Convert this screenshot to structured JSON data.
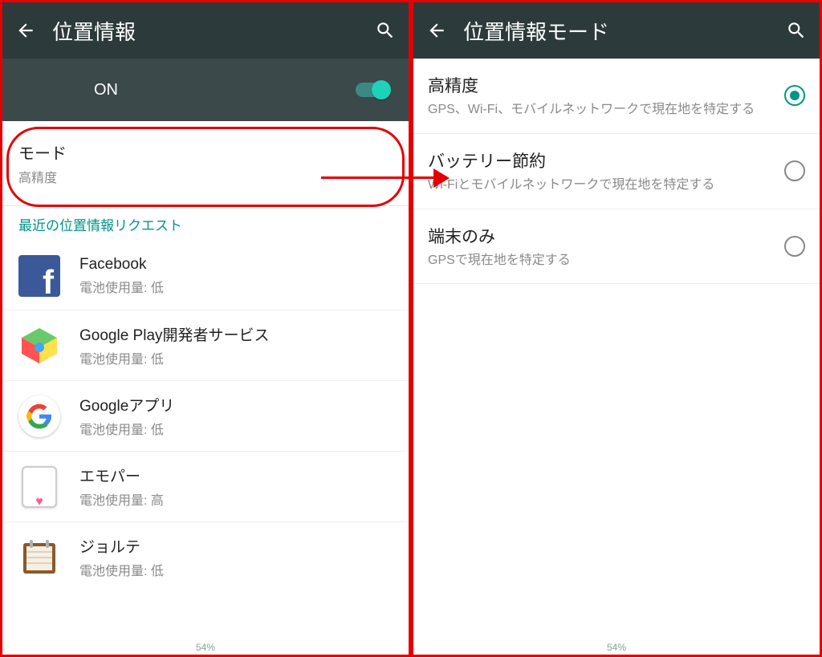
{
  "left": {
    "title": "位置情報",
    "toggle_label": "ON",
    "mode": {
      "label": "モード",
      "value": "高精度"
    },
    "recent_header": "最近の位置情報リクエスト",
    "apps": [
      {
        "name": "Facebook",
        "battery": "電池使用量: 低"
      },
      {
        "name": "Google Play開発者サービス",
        "battery": "電池使用量: 低"
      },
      {
        "name": "Googleアプリ",
        "battery": "電池使用量: 低"
      },
      {
        "name": "エモパー",
        "battery": "電池使用量: 高"
      },
      {
        "name": "ジョルテ",
        "battery": "電池使用量: 低"
      }
    ],
    "footer": "54%"
  },
  "right": {
    "title": "位置情報モード",
    "options": [
      {
        "label": "高精度",
        "desc": "GPS、Wi-Fi、モバイルネットワークで現在地を特定する",
        "selected": true
      },
      {
        "label": "バッテリー節約",
        "desc": "Wi-Fiとモバイルネットワークで現在地を特定する",
        "selected": false
      },
      {
        "label": "端末のみ",
        "desc": "GPSで現在地を特定する",
        "selected": false
      }
    ],
    "footer": "54%"
  }
}
